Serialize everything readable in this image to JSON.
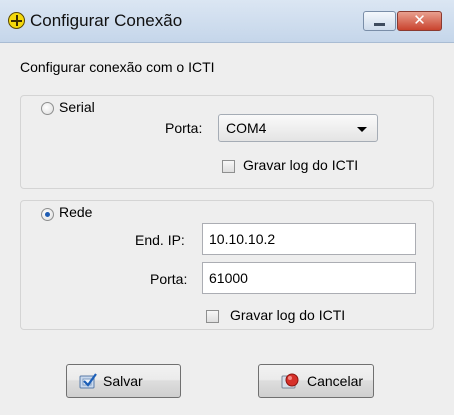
{
  "window": {
    "title": "Configurar Conexão",
    "close_glyph": "✕"
  },
  "subtitle": "Configurar conexão com o ICTI",
  "serial": {
    "radio_label": "Serial",
    "porta_label": "Porta:",
    "porta_value": "COM4",
    "log_label": "Gravar log do ICTI"
  },
  "rede": {
    "radio_label": "Rede",
    "ip_label": "End. IP:",
    "ip_value": "10.10.10.2",
    "porta_label": "Porta:",
    "porta_value": "61000",
    "log_label": "Gravar log do ICTI"
  },
  "buttons": {
    "save": "Salvar",
    "cancel": "Cancelar"
  },
  "colors": {
    "radio_selected": "#1e5cb3",
    "close_button": "#c9432e"
  }
}
